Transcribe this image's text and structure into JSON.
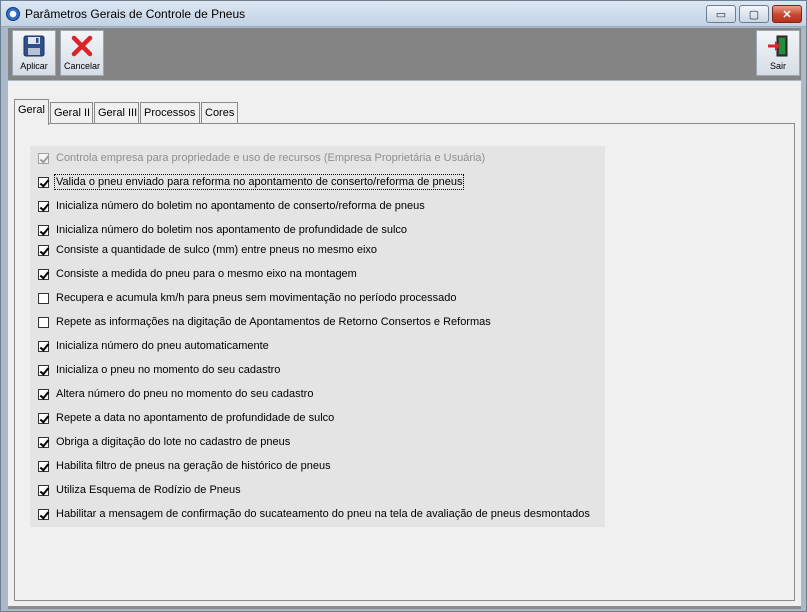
{
  "window": {
    "title": "Parâmetros Gerais de Controle de Pneus",
    "controls": {
      "minimize": "▭",
      "maximize": "▢",
      "close": "✕"
    }
  },
  "toolbar": {
    "apply_label": "Aplicar",
    "cancel_label": "Cancelar",
    "exit_label": "Sair"
  },
  "tabs": [
    {
      "label": "Geral",
      "active": true
    },
    {
      "label": "Geral II",
      "active": false
    },
    {
      "label": "Geral III",
      "active": false
    },
    {
      "label": "Processos",
      "active": false
    },
    {
      "label": "Cores",
      "active": false
    }
  ],
  "options": [
    {
      "label": "Controla empresa para propriedade e uso de recursos (Empresa Proprietária e Usuária)",
      "checked": true,
      "disabled": true
    },
    {
      "label": "Valida o pneu enviado para reforma no apontamento de conserto/reforma de pneus",
      "checked": true,
      "focused": true
    },
    {
      "label": "Inicializa número do boletim no apontamento de conserto/reforma de pneus",
      "checked": true
    },
    {
      "label": "Inicializa número do boletim nos apontamento de profundidade de sulco",
      "checked": true
    },
    {
      "label": "Consiste a quantidade de sulco (mm) entre pneus no mesmo eixo",
      "checked": true
    },
    {
      "label": "Consiste a medida do pneu para o mesmo eixo na montagem",
      "checked": true
    },
    {
      "label": "Recupera e acumula km/h para pneus sem movimentação no período processado",
      "checked": false
    },
    {
      "label": "Repete as informações na digitação de Apontamentos de Retorno Consertos e Reformas",
      "checked": false
    },
    {
      "label": "Inicializa número do pneu automaticamente",
      "checked": true
    },
    {
      "label": "Inicializa o pneu no momento do seu cadastro",
      "checked": true
    },
    {
      "label": "Altera número do pneu no momento do seu cadastro",
      "checked": true
    },
    {
      "label": "Repete a data no apontamento de profundidade de sulco",
      "checked": true
    },
    {
      "label": "Obriga a digitação do lote no cadastro de pneus",
      "checked": true
    },
    {
      "label": "Habilita filtro de pneus na geração de histórico de pneus",
      "checked": true
    },
    {
      "label": "Utiliza Esquema de Rodízio de Pneus",
      "checked": true
    },
    {
      "label": "Habilitar a mensagem de confirmação do sucateamento do pneu na tela de avaliação de pneus desmontados",
      "checked": true
    }
  ]
}
